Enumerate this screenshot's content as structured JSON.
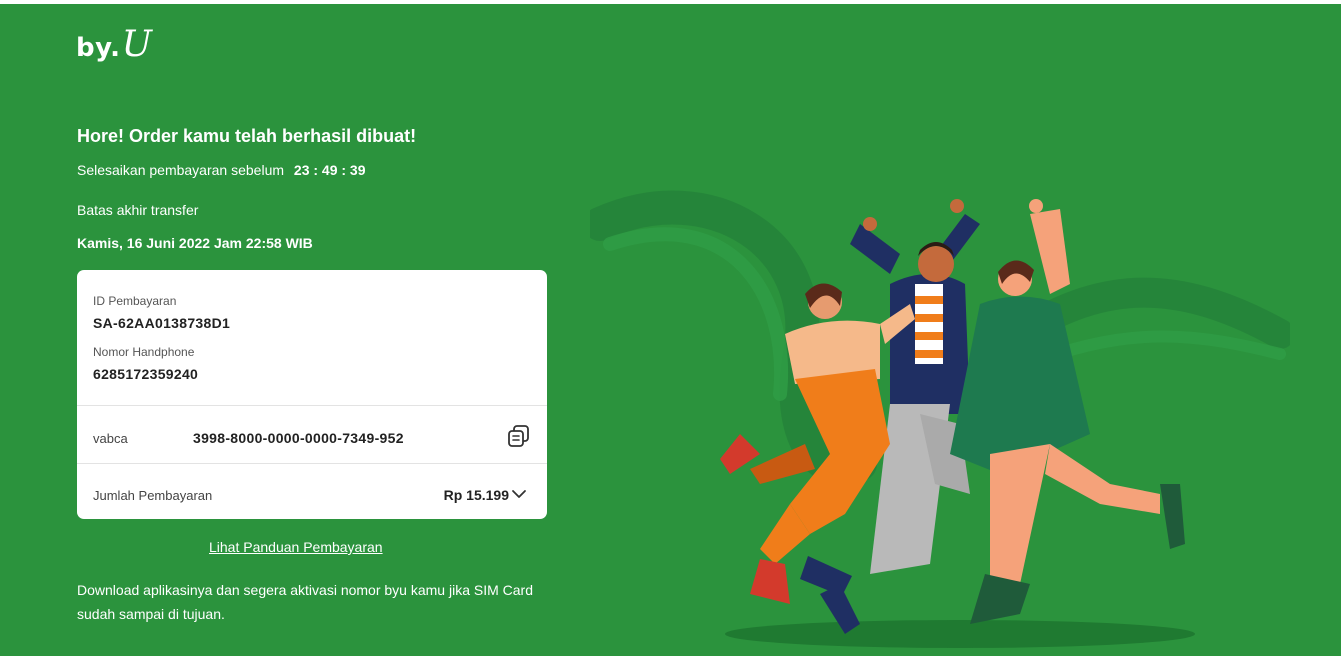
{
  "brand": {
    "logo_main": "by.",
    "logo_accent": "U"
  },
  "order": {
    "headline": "Hore! Order kamu telah berhasil dibuat!",
    "deadline_prefix": "Selesaikan pembayaran sebelum",
    "countdown": "23 : 49 : 39",
    "transfer_deadline_label": "Batas akhir transfer",
    "transfer_deadline_value": "Kamis, 16 Juni 2022 Jam 22:58 WIB"
  },
  "payment_card": {
    "payment_id_label": "ID Pembayaran",
    "payment_id_value": "SA-62AA0138738D1",
    "phone_label": "Nomor Handphone",
    "phone_value": "6285172359240",
    "va_bank": "vabca",
    "va_number": "3998-8000-0000-0000-7349-952",
    "total_label": "Jumlah Pembayaran",
    "total_value": "Rp 15.199"
  },
  "links": {
    "payment_guide": "Lihat Panduan Pembayaran"
  },
  "footer": {
    "download_text": "Download aplikasinya dan segera aktivasi nomor byu kamu jika SIM Card sudah sampai di tujuan."
  },
  "colors": {
    "background": "#2b933d",
    "card": "#ffffff",
    "accent_orange": "#f07d1a",
    "accent_navy": "#1f2f63",
    "dress_green": "#1e7a4f"
  },
  "icons": {
    "copy": "copy-icon",
    "expand": "chevron-down-icon"
  }
}
